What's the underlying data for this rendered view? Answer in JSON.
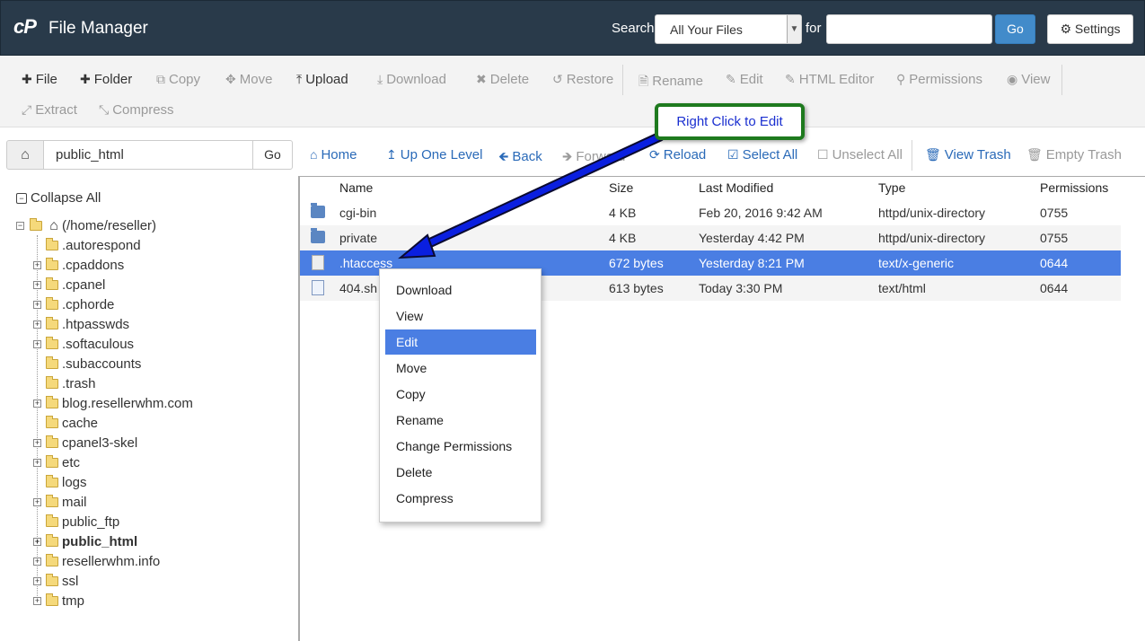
{
  "header": {
    "logo": "cP",
    "title": "File Manager",
    "search_label": "Search",
    "search_scope": "All Your Files",
    "for_label": "for",
    "search_value": "",
    "go_label": "Go",
    "settings_label": "Settings"
  },
  "toolbar": {
    "file": "File",
    "folder": "Folder",
    "copy": "Copy",
    "move": "Move",
    "upload": "Upload",
    "download": "Download",
    "delete": "Delete",
    "restore": "Restore",
    "rename": "Rename",
    "edit": "Edit",
    "html_editor": "HTML Editor",
    "permissions": "Permissions",
    "view": "View",
    "extract": "Extract",
    "compress": "Compress"
  },
  "pathbar": {
    "path": "public_html",
    "go_label": "Go"
  },
  "nav": {
    "home": "Home",
    "up_one_level": "Up One Level",
    "back": "Back",
    "forward": "Forward",
    "reload": "Reload",
    "select_all": "Select All",
    "unselect_all": "Unselect All",
    "view_trash": "View Trash",
    "empty_trash": "Empty Trash"
  },
  "tree": {
    "collapse_all": "Collapse All",
    "root": "(/home/reseller)",
    "items": [
      {
        "name": ".autorespond",
        "expandable": false
      },
      {
        "name": ".cpaddons",
        "expandable": true
      },
      {
        "name": ".cpanel",
        "expandable": true
      },
      {
        "name": ".cphorde",
        "expandable": true
      },
      {
        "name": ".htpasswds",
        "expandable": true
      },
      {
        "name": ".softaculous",
        "expandable": true
      },
      {
        "name": ".subaccounts",
        "expandable": false
      },
      {
        "name": ".trash",
        "expandable": false
      },
      {
        "name": "blog.resellerwhm.com",
        "expandable": true
      },
      {
        "name": "cache",
        "expandable": false
      },
      {
        "name": "cpanel3-skel",
        "expandable": true
      },
      {
        "name": "etc",
        "expandable": true
      },
      {
        "name": "logs",
        "expandable": false
      },
      {
        "name": "mail",
        "expandable": true
      },
      {
        "name": "public_ftp",
        "expandable": false
      },
      {
        "name": "public_html",
        "expandable": true,
        "current": true
      },
      {
        "name": "resellerwhm.info",
        "expandable": true
      },
      {
        "name": "ssl",
        "expandable": true
      },
      {
        "name": "tmp",
        "expandable": true
      }
    ]
  },
  "table": {
    "columns": [
      "Name",
      "Size",
      "Last Modified",
      "Type",
      "Permissions"
    ],
    "rows": [
      {
        "name": "cgi-bin",
        "size": "4 KB",
        "modified": "Feb 20, 2016 9:42 AM",
        "type": "httpd/unix-directory",
        "perms": "0755",
        "icon": "folder-icon"
      },
      {
        "name": "private",
        "size": "4 KB",
        "modified": "Yesterday 4:42 PM",
        "type": "httpd/unix-directory",
        "perms": "0755",
        "icon": "folder-icon"
      },
      {
        "name": ".htaccess",
        "size": "672 bytes",
        "modified": "Yesterday 8:21 PM",
        "type": "text/x-generic",
        "perms": "0644",
        "icon": "text-file-icon",
        "selected": true
      },
      {
        "name": "404.sh",
        "size": "613 bytes",
        "modified": "Today 3:30 PM",
        "type": "text/html",
        "perms": "0644",
        "icon": "html-file-icon"
      }
    ]
  },
  "context_menu": {
    "items": [
      "Download",
      "View",
      "Edit",
      "Move",
      "Copy",
      "Rename",
      "Change Permissions",
      "Delete",
      "Compress"
    ],
    "active": "Edit"
  },
  "annotation": {
    "text": "Right Click to Edit"
  },
  "colors": {
    "header_bg": "#293a4a",
    "accent": "#428bca",
    "selection": "#4a7ee3",
    "callout_border": "#1e7a1e",
    "arrow": "#0a1fe0"
  }
}
